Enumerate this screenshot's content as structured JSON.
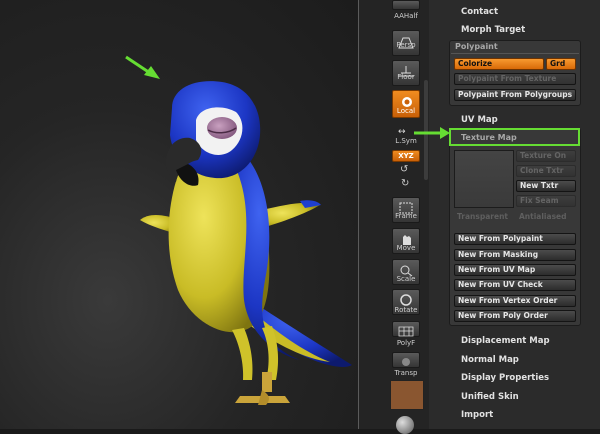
{
  "shelf": {
    "aahalf_label": "AAHalf",
    "persp_label": "Persp",
    "floor_label": "Floor",
    "local_label": "Local",
    "lsym_label": "L.Sym",
    "xyz_label": "XYZ",
    "frame_label": "Frame",
    "move_label": "Move",
    "scale_label": "Scale",
    "rotate_label": "Rotate",
    "polyf_label": "PolyF",
    "transp_label": "Transp"
  },
  "panel": {
    "contact": "Contact",
    "morph_target": "Morph Target",
    "polypaint": {
      "title": "Polypaint",
      "colorize": "Colorize",
      "grd": "Grd",
      "from_texture": "Polypaint From Texture",
      "from_polygroups": "Polypaint From Polygroups"
    },
    "uv_map": "UV Map",
    "texture_map": {
      "title": "Texture Map",
      "texture_on": "Texture On",
      "clone_txtr": "Clone Txtr",
      "new_txtr": "New Txtr",
      "fix_seam": "Fix Seam",
      "transparent": "Transparent",
      "antialiased": "Antialiased",
      "new_from_buttons": [
        "New From Polypaint",
        "New From Masking",
        "New From UV Map",
        "New From UV Check",
        "New From Vertex Order",
        "New From Poly Order"
      ]
    },
    "displacement_map": "Displacement Map",
    "normal_map": "Normal Map",
    "display_properties": "Display Properties",
    "unified_skin": "Unified Skin",
    "import": "Import"
  },
  "colors": {
    "accent_orange": "#f08c20",
    "highlight_green": "#66dd33",
    "parrot_blue": "#1f3fd0",
    "parrot_yellow": "#d8cc30"
  }
}
